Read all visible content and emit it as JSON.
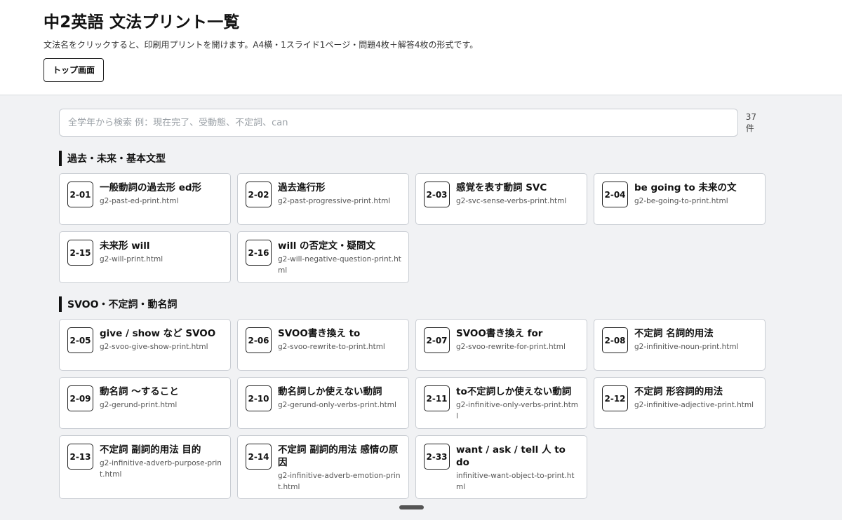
{
  "header": {
    "title": "中2英語 文法プリント一覧",
    "subtitle": "文法名をクリックすると、印刷用プリントを開けます。A4横・1スライド1ページ・問題4枚＋解答4枚の形式です。",
    "top_button": "トップ画面"
  },
  "search": {
    "placeholder": "全学年から検索 例：現在完了、受動態、不定詞、can",
    "count": "37件"
  },
  "sections": [
    {
      "title": "過去・未来・基本文型",
      "cards": [
        {
          "code": "2-01",
          "title": "一般動詞の過去形 ed形",
          "file": "g2-past-ed-print.html"
        },
        {
          "code": "2-02",
          "title": "過去進行形",
          "file": "g2-past-progressive-print.html"
        },
        {
          "code": "2-03",
          "title": "感覚を表す動詞 SVC",
          "file": "g2-svc-sense-verbs-print.html"
        },
        {
          "code": "2-04",
          "title": "be going to 未来の文",
          "file": "g2-be-going-to-print.html"
        },
        {
          "code": "2-15",
          "title": "未来形 will",
          "file": "g2-will-print.html"
        },
        {
          "code": "2-16",
          "title": "will の否定文・疑問文",
          "file": "g2-will-negative-question-print.html"
        }
      ]
    },
    {
      "title": "SVOO・不定詞・動名詞",
      "cards": [
        {
          "code": "2-05",
          "title": "give / show など SVOO",
          "file": "g2-svoo-give-show-print.html"
        },
        {
          "code": "2-06",
          "title": "SVOO書き換え to",
          "file": "g2-svoo-rewrite-to-print.html"
        },
        {
          "code": "2-07",
          "title": "SVOO書き換え for",
          "file": "g2-svoo-rewrite-for-print.html"
        },
        {
          "code": "2-08",
          "title": "不定詞 名詞的用法",
          "file": "g2-infinitive-noun-print.html"
        },
        {
          "code": "2-09",
          "title": "動名詞 〜すること",
          "file": "g2-gerund-print.html"
        },
        {
          "code": "2-10",
          "title": "動名詞しか使えない動詞",
          "file": "g2-gerund-only-verbs-print.html"
        },
        {
          "code": "2-11",
          "title": "to不定詞しか使えない動詞",
          "file": "g2-infinitive-only-verbs-print.html"
        },
        {
          "code": "2-12",
          "title": "不定詞 形容詞的用法",
          "file": "g2-infinitive-adjective-print.html"
        },
        {
          "code": "2-13",
          "title": "不定詞 副詞的用法 目的",
          "file": "g2-infinitive-adverb-purpose-print.html"
        },
        {
          "code": "2-14",
          "title": "不定詞 副詞的用法 感情の原因",
          "file": "g2-infinitive-adverb-emotion-print.html"
        },
        {
          "code": "2-33",
          "title": "want / ask / tell 人 to do",
          "file": "infinitive-want-object-to-print.html"
        }
      ]
    }
  ]
}
